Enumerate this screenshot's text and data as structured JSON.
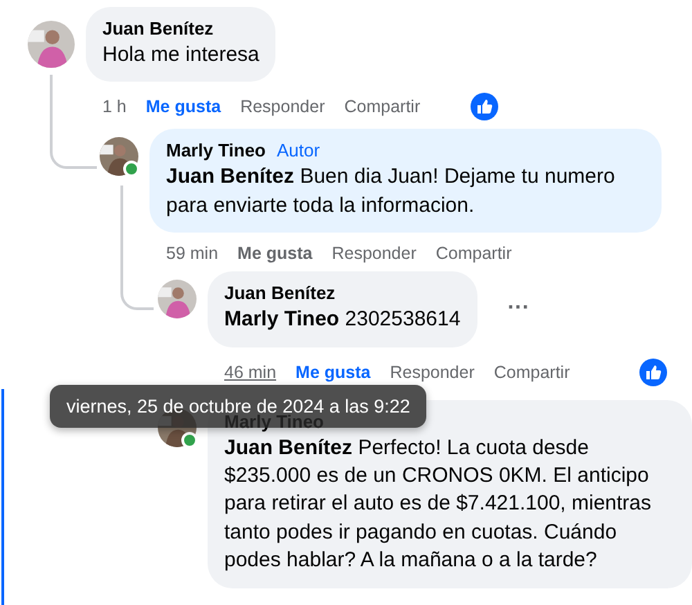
{
  "comments": [
    {
      "author": "Juan Benítez",
      "text": "Hola me interesa",
      "time": "1 h",
      "time_hovered": false,
      "liked": true,
      "reaction": true,
      "actions": [
        "Me gusta",
        "Responder",
        "Compartir"
      ],
      "children": [
        {
          "author": "Marly Tineo",
          "badge": "Autor",
          "mention": "Juan Benítez",
          "text": "Buen dia Juan! Dejame tu numero para enviarte toda la informacion.",
          "online": true,
          "time": "59 min",
          "time_hovered": false,
          "liked": false,
          "actions": [
            "Me gusta",
            "Responder",
            "Compartir"
          ],
          "children": [
            {
              "author": "Juan Benítez",
              "mention": "Marly Tineo",
              "text": "2302538614",
              "menu": true,
              "menu_label": "···",
              "time": "46 min",
              "time_hovered": true,
              "liked": true,
              "reaction": true,
              "actions": [
                "Me gusta",
                "Responder",
                "Compartir"
              ]
            },
            {
              "author": "Marly Tineo",
              "mention": "Juan Benítez",
              "text": "Perfecto! La cuota desde $235.000 es de un CRONOS 0KM. El anticipo para retirar el auto es de $7.421.100, mientras tanto podes ir pagando en cuotas. Cuándo podes hablar? A la mañana o a la tarde?",
              "online": true,
              "highlighted": true
            }
          ]
        }
      ]
    }
  ],
  "tooltip": {
    "text": "viernes, 25 de octubre de 2024 a las 9:22"
  }
}
